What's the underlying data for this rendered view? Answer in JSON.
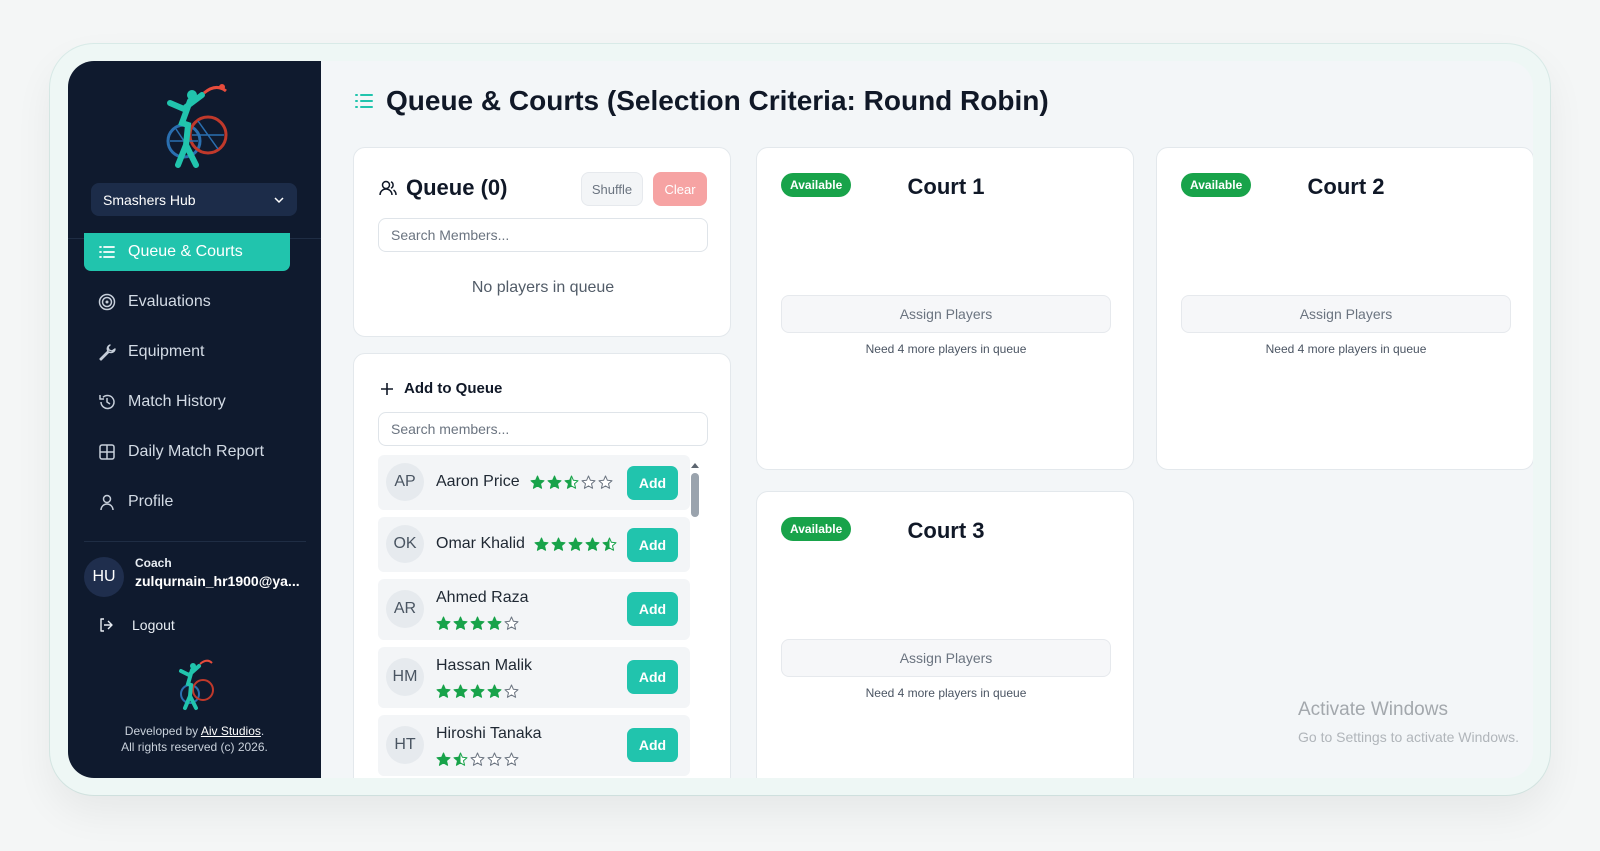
{
  "club": {
    "name": "Smashers Hub"
  },
  "nav": [
    {
      "label": "Queue & Courts",
      "icon": "list-icon",
      "active": true
    },
    {
      "label": "Evaluations",
      "icon": "target-icon",
      "active": false
    },
    {
      "label": "Equipment",
      "icon": "wrench-icon",
      "active": false
    },
    {
      "label": "Match History",
      "icon": "history-icon",
      "active": false
    },
    {
      "label": "Daily Match Report",
      "icon": "grid-icon",
      "active": false
    },
    {
      "label": "Profile",
      "icon": "user-icon",
      "active": false
    }
  ],
  "user": {
    "initials": "HU",
    "role": "Coach",
    "email": "zulqurnain_hr1900@ya..."
  },
  "logout_label": "Logout",
  "footer": {
    "developed_by": "Developed by",
    "studio": "Aiv Studios",
    "rights": "All rights reserved (c) 2026."
  },
  "page": {
    "title": "Queue & Courts (Selection Criteria: Round Robin)"
  },
  "queue": {
    "title": "Queue (0)",
    "shuffle_label": "Shuffle",
    "clear_label": "Clear",
    "search_placeholder": "Search Members...",
    "empty_text": "No players in queue"
  },
  "add_to_queue": {
    "title": "Add to Queue",
    "search_placeholder": "Search members...",
    "add_label": "Add",
    "members": [
      {
        "initials": "AP",
        "name": "Aaron Price",
        "rating": 2.5
      },
      {
        "initials": "OK",
        "name": "Omar Khalid",
        "rating": 4.5
      },
      {
        "initials": "AR",
        "name": "Ahmed Raza",
        "rating": 4
      },
      {
        "initials": "HM",
        "name": "Hassan Malik",
        "rating": 4
      },
      {
        "initials": "HT",
        "name": "Hiroshi Tanaka",
        "rating": 1.5
      }
    ]
  },
  "courts": [
    {
      "name": "Court 1",
      "status": "Available",
      "assign_label": "Assign Players",
      "note": "Need 4 more players in queue"
    },
    {
      "name": "Court 2",
      "status": "Available",
      "assign_label": "Assign Players",
      "note": "Need 4 more players in queue"
    },
    {
      "name": "Court 3",
      "status": "Available",
      "assign_label": "Assign Players",
      "note": "Need 4 more players in queue"
    }
  ],
  "colors": {
    "accent": "#21c4ad",
    "sidebar": "#0f1a2e",
    "available": "#18a34a",
    "clear": "#f6a3a3",
    "star": "#18a34a"
  },
  "watermark": {
    "line1": "Activate Windows",
    "line2": "Go to Settings to activate Windows."
  }
}
